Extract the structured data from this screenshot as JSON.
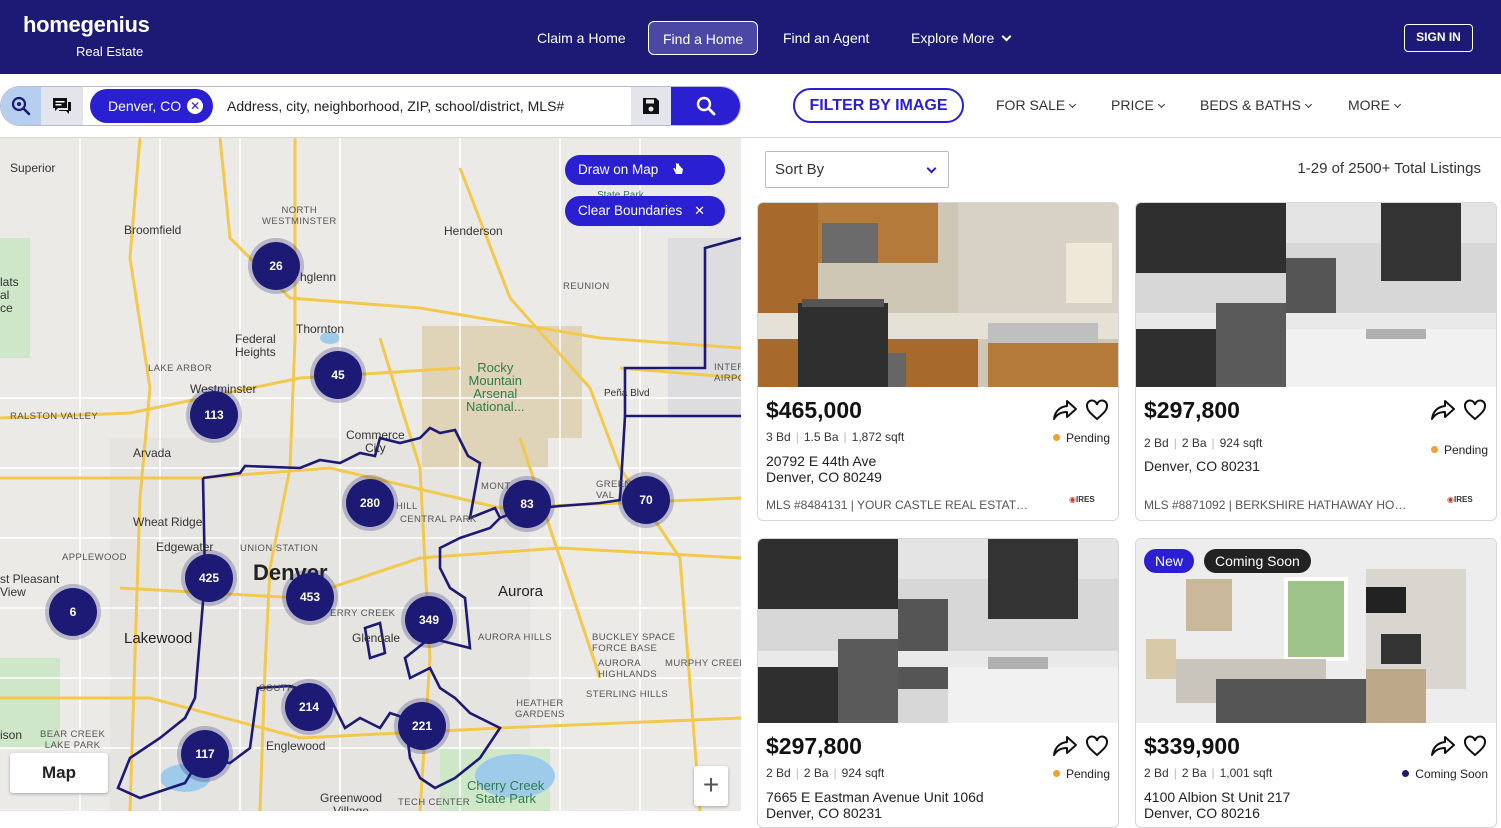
{
  "header": {
    "logo": "homegenius",
    "logo_sub": "Real Estate",
    "nav": [
      "Claim a Home",
      "Find a Home",
      "Find an Agent",
      "Explore More"
    ],
    "signin": "SIGN IN",
    "bg_color": "#1c1a75"
  },
  "search": {
    "chip": "Denver, CO",
    "placeholder": "Address, city, neighborhood, ZIP, school/district, MLS#",
    "accent": "#2a1fd1"
  },
  "filters": {
    "filter_by_image": "FILTER BY IMAGE",
    "for_sale": "FOR SALE",
    "price": "PRICE",
    "beds_baths": "BEDS & BATHS",
    "more": "MORE"
  },
  "map": {
    "draw_on_map": "Draw on Map",
    "clear_boundaries": "Clear Boundaries",
    "map_type": "Map",
    "zoom_in": "+",
    "labels": {
      "superior": "Superior",
      "north_westminster": "NORTH\nWESTMINSTER",
      "broomfield": "Broomfield",
      "henderson": "Henderson",
      "reunion": "REUNION",
      "northglenn": "hglenn",
      "thornton": "Thornton",
      "federal_heights": "Federal\nHeights",
      "lake_arbor": "LAKE ARBOR",
      "westminster": "Westminster",
      "ralston_valley": "RALSTON VALLEY",
      "arvada": "Arvada",
      "commerce_city": "Commerce\nCity",
      "rocky_mountain": "Rocky\nMountain\nArsenal\nNational...",
      "pena_blvd": "Peña Blvd",
      "wheat_ridge": "Wheat Ridge",
      "edgewater": "Edgewater",
      "applewood": "APPLEWOOD",
      "union_station": "UNION STATION",
      "central_park": "CENTRAL PARK",
      "denver": "Denver",
      "aurora": "Aurora",
      "lakewood": "Lakewood",
      "glendale": "Glendale",
      "aurora_hills": "AURORA HILLS",
      "buckley": "BUCKLEY SPACE\nFORCE BASE",
      "aurora_highlands": "AURORA\nHIGHLANDS",
      "murphy_creek": "MURPHY CREEK",
      "sterling_hills": "STERLING HILLS",
      "heather_gardens": "HEATHER\nGARDENS",
      "englewood": "Englewood",
      "bear_creek": "BEAR CREEK\nLAKE PARK",
      "cherry_creek": "Cherry Creek\nState Park",
      "greenwood": "Greenwood\nVillage",
      "tech_center": "TECH CENTER",
      "pleasant_view": "st Pleasant\nView",
      "lats": "lats\nal\nce",
      "ison": "ison",
      "inter": "INTER\nAIRPO",
      "green": "GREEN\nVAL",
      "mont": "MONT",
      "hill": "HILL",
      "erry_creek": "ERRY CREEK",
      "south": "SOUTH",
      "state_park": "State Park"
    },
    "clusters": [
      "26",
      "45",
      "113",
      "280",
      "83",
      "70",
      "425",
      "453",
      "349",
      "6",
      "214",
      "221",
      "117"
    ],
    "cluster_color": "#1c1a75"
  },
  "listings": {
    "sort_label": "Sort By",
    "total": "1-29 of 2500+ Total Listings",
    "cards": [
      {
        "price": "$465,000",
        "beds": "3 Bd",
        "baths": "1.5 Ba",
        "sqft": "1,872 sqft",
        "status": "Pending",
        "status_color": "#f0a030",
        "addr1": "20792 E 44th Ave",
        "addr2": "Denver, CO 80249",
        "mls": "MLS #8484131 | YOUR CASTLE REAL ESTATE INC",
        "ires": "IRES"
      },
      {
        "price": "$297,800",
        "beds": "2 Bd",
        "baths": "2 Ba",
        "sqft": "924 sqft",
        "status": "Pending",
        "status_color": "#f0a030",
        "addr1": "Denver, CO 80231",
        "addr2": "",
        "mls": "MLS #8871092 | BERKSHIRE HATHAWAY HOMES...",
        "ires": "IRES"
      },
      {
        "price": "$297,800",
        "beds": "2 Bd",
        "baths": "2 Ba",
        "sqft": "924 sqft",
        "status": "Pending",
        "status_color": "#f0a030",
        "addr1": "7665 E Eastman Avenue Unit 106d",
        "addr2": "Denver, CO 80231",
        "mls": "",
        "ires": ""
      },
      {
        "price": "$339,900",
        "beds": "2 Bd",
        "baths": "2 Ba",
        "sqft": "1,001 sqft",
        "status": "Coming Soon",
        "status_color": "#1c1a75",
        "addr1": "4100 Albion St Unit 217",
        "addr2": "Denver, CO 80216",
        "mls": "",
        "ires": "",
        "badge_new": "New",
        "badge_coming": "Coming Soon"
      }
    ]
  }
}
